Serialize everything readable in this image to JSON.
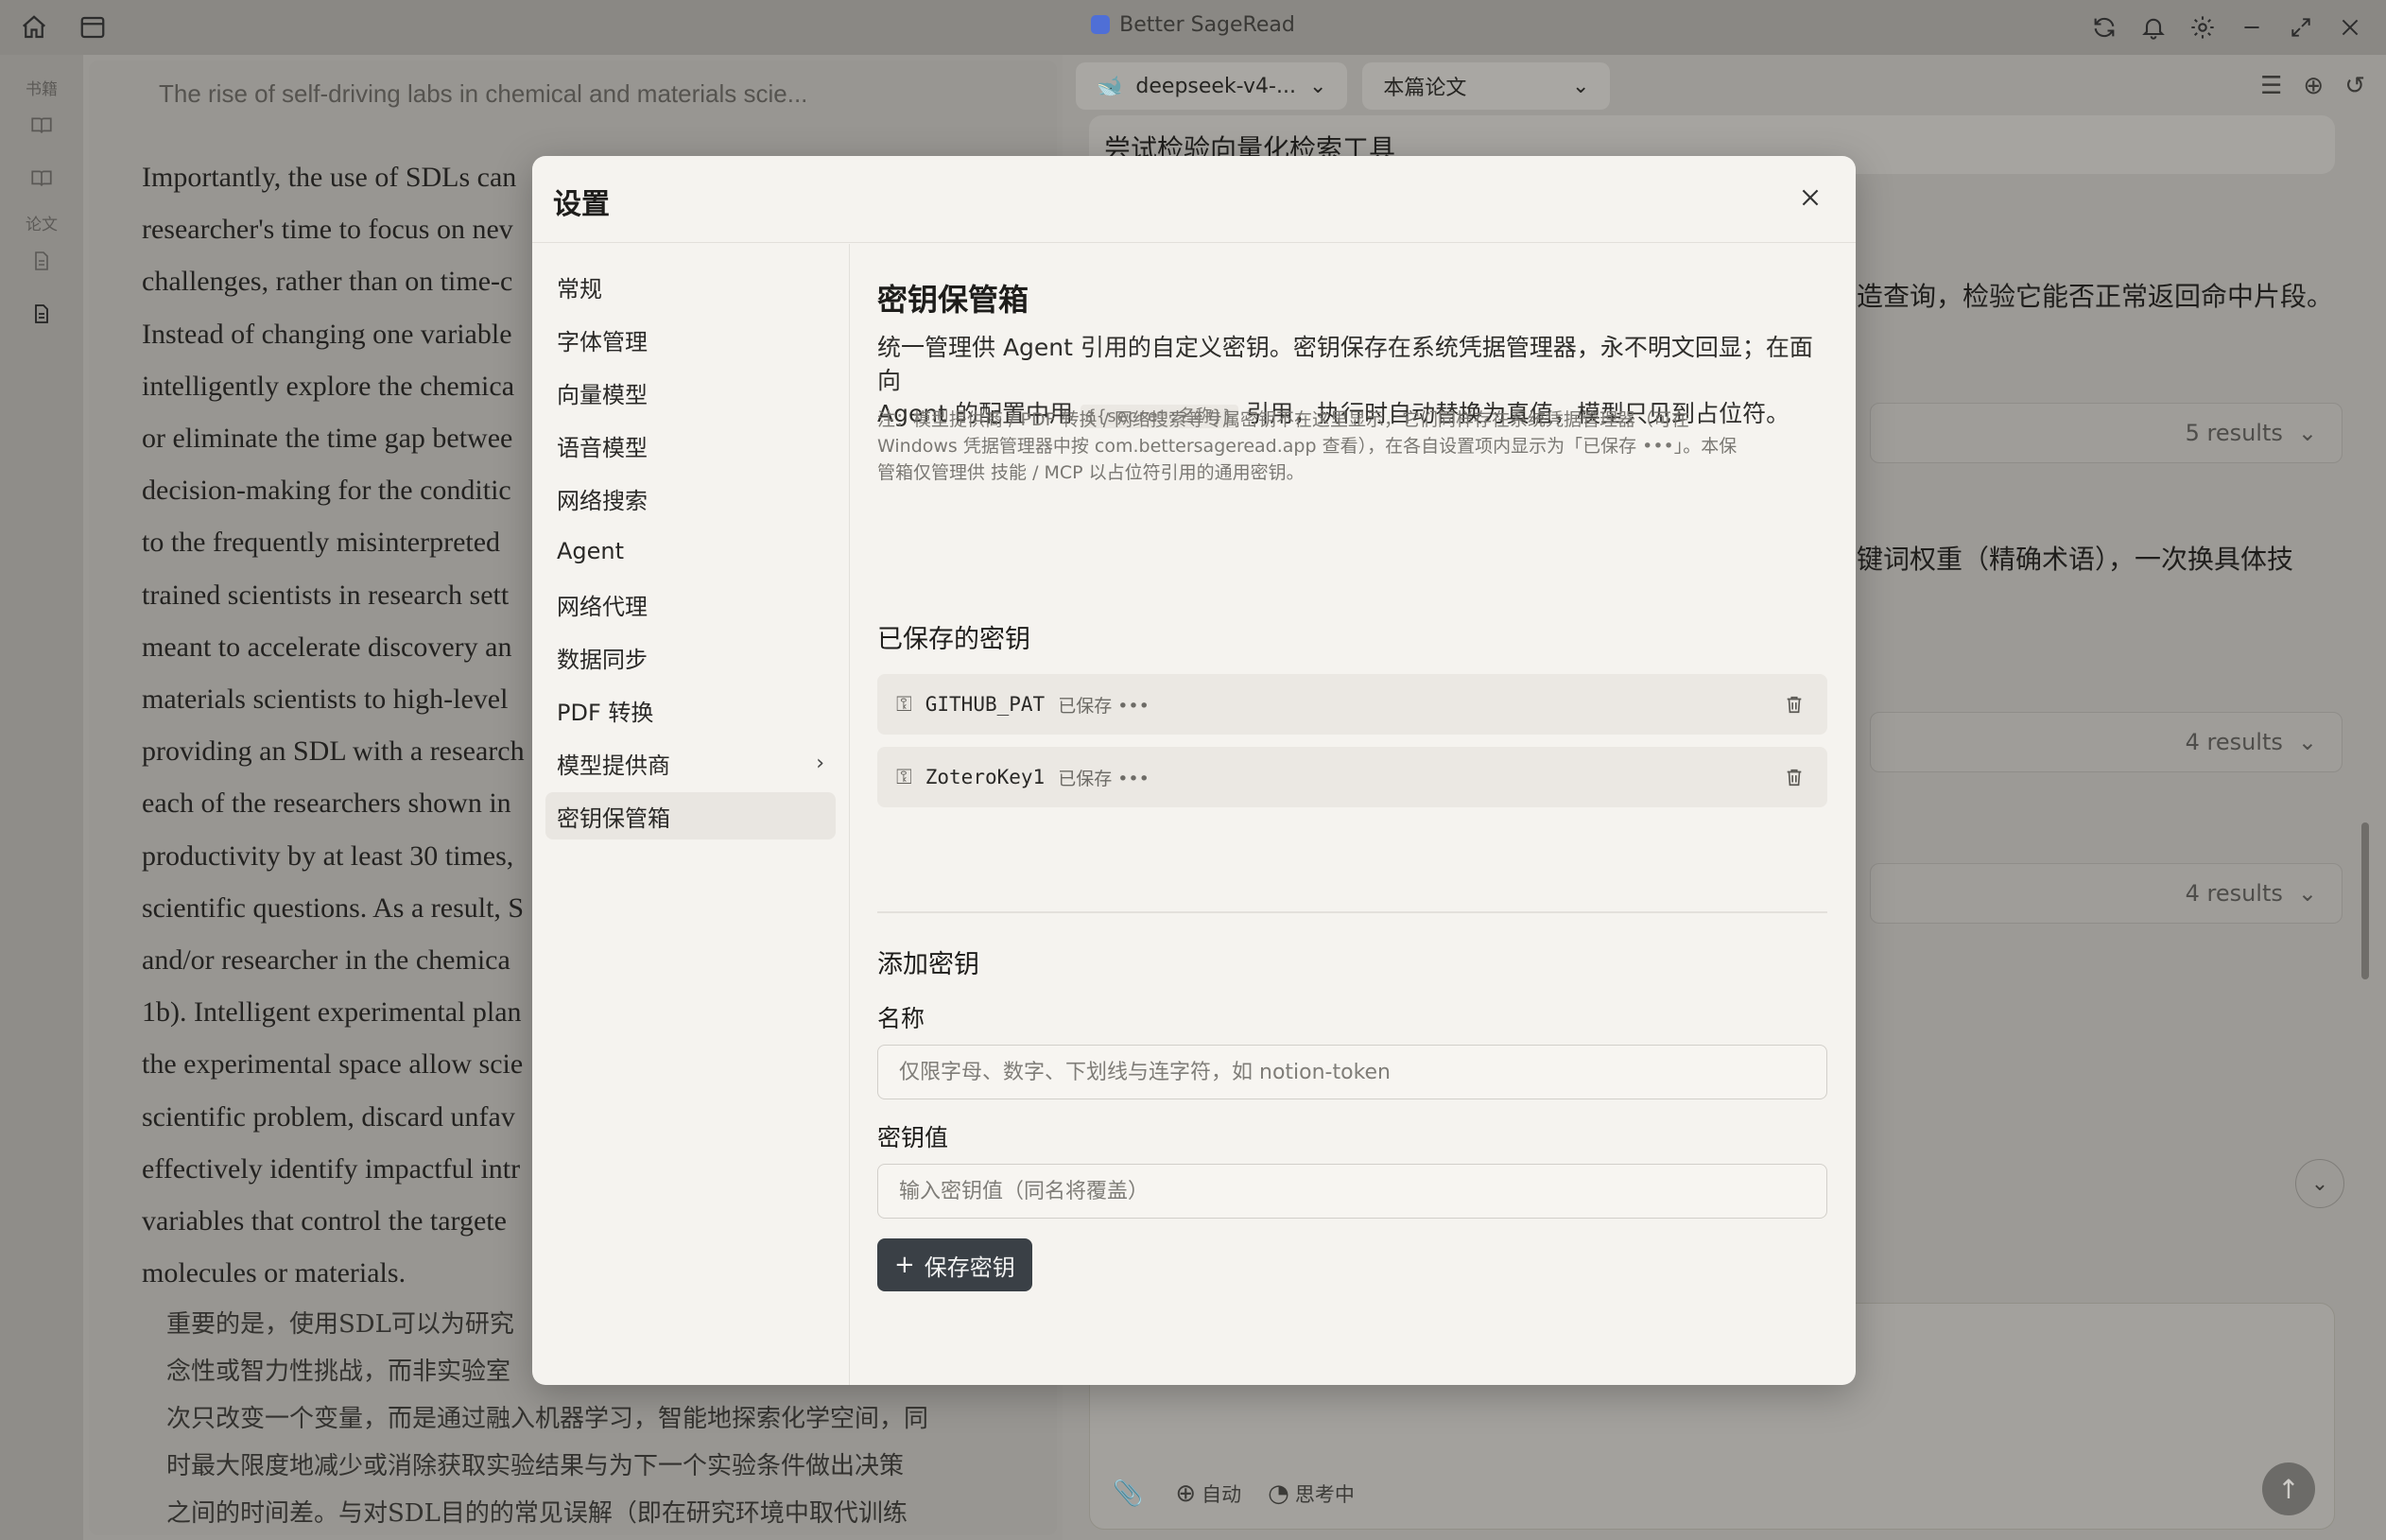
{
  "window": {
    "title": "Better SageRead",
    "left_icons": [
      "home-icon",
      "layout-icon"
    ],
    "right_icons": [
      "sync-icon",
      "bell-icon",
      "gear-icon",
      "minimize-icon",
      "maximize-icon",
      "close-icon"
    ]
  },
  "rail": {
    "books_label": "书籍",
    "papers_label": "论文"
  },
  "reader": {
    "title": "The rise of self-driving labs in chemical and materials scie...",
    "lines": [
      "Importantly, the use of SDLs can",
      "researcher's time to focus on nev",
      "challenges, rather than on time-c",
      "Instead of changing one variable",
      "intelligently explore the chemica",
      "or eliminate the time gap betwee",
      "decision-making for the conditic",
      "to the frequently misinterpreted",
      "trained scientists in research sett",
      "meant to accelerate discovery an",
      "materials scientists to high-level",
      "providing an SDL with a research",
      "each of the researchers shown in",
      "productivity by at least 30 times,",
      "scientific questions. As a result, S",
      "and/or researcher in the chemica",
      "1b). Intelligent experimental plan",
      "the experimental space allow scie",
      "scientific problem, discard unfav",
      "effectively identify impactful intr",
      "variables that control the targete",
      "molecules or materials."
    ],
    "cn_lines": [
      "重要的是，使用SDL可以为研究",
      "念性或智力性挑战，而非实验室",
      "次只改变一个变量，而是通过融入机器学习，智能地探索化学空间，同",
      "时最大限度地减少或消除获取实验结果与为下一个实验条件做出决策",
      "之间的时间差。与对SDL目的的常见误解（即在研究环境中取代训练"
    ]
  },
  "chat": {
    "model_label": "deepseek-v4-...",
    "scope_label": "本篇论文",
    "query": "尝试检验向量化检索工具",
    "line_1": "造查询，检验它能否正常返回命中片段。",
    "line_2": "键词权重（精确术语），一次换具体技",
    "results_1": "5 results",
    "results_2": "4 results",
    "results_3": "4 results",
    "auto_label": "自动",
    "thinking_label": "思考中"
  },
  "settings": {
    "title": "设置",
    "nav": [
      {
        "label": "常规"
      },
      {
        "label": "字体管理"
      },
      {
        "label": "向量模型"
      },
      {
        "label": "语音模型"
      },
      {
        "label": "网络搜索"
      },
      {
        "label": "Agent"
      },
      {
        "label": "网络代理"
      },
      {
        "label": "数据同步"
      },
      {
        "label": "PDF 转换"
      },
      {
        "label": "模型提供商"
      },
      {
        "label": "密钥保管箱"
      }
    ],
    "vault": {
      "title": "密钥保管箱",
      "desc_1": "统一管理供 Agent 引用的自定义密钥。密钥保存在系统凭据管理器，永不明文回显；在面向",
      "desc_2a": "Agent 的配置中用 ",
      "desc_code": "{{secret:名称}}",
      "desc_2b": " 引用，执行时自动替换为真值，模型只见到占位符。",
      "note_1": "注：模型提供商 / PDF 转换 / 网络搜索等专属密钥不在这里显示，它们同样存在系统凭据管理器（可在",
      "note_2": "Windows 凭据管理器中按 com.bettersageread.app 查看），在各自设置项内显示为「已保存 •••」。本保",
      "note_3": "管箱仅管理供 技能 / MCP 以占位符引用的通用密钥。",
      "saved_title": "已保存的密钥",
      "keys": [
        {
          "name": "GITHUB_PAT",
          "status": "已保存 •••"
        },
        {
          "name": "ZoteroKey1",
          "status": "已保存 •••"
        }
      ],
      "add_title": "添加密钥",
      "name_label": "名称",
      "name_placeholder": "仅限字母、数字、下划线与连字符，如 notion-token",
      "value_label": "密钥值",
      "value_placeholder": "输入密钥值（同名将覆盖）",
      "save_label": "保存密钥"
    }
  }
}
